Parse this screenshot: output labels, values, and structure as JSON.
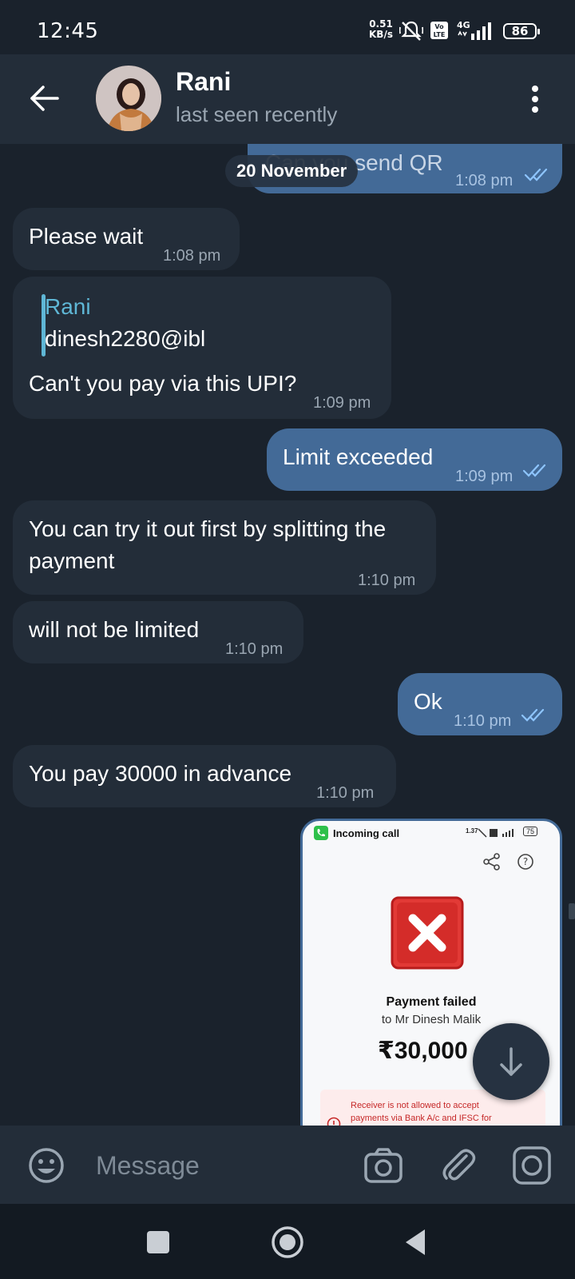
{
  "status_bar": {
    "time": "12:45",
    "speed_value": "0.51",
    "speed_unit": "KB/s",
    "network": "4G",
    "volte": "Vo LTE",
    "battery": "86"
  },
  "header": {
    "name": "Rani",
    "status": "last seen recently"
  },
  "date_separator": "20 November",
  "messages": [
    {
      "side": "out",
      "text": "Can you send QR",
      "time": "1:08 pm"
    },
    {
      "side": "in",
      "text": "Please wait",
      "time": "1:08 pm"
    },
    {
      "side": "in",
      "reply_name": "Rani",
      "reply_text": "dinesh2280@ibl",
      "text": "Can't you pay via this UPI?",
      "time": "1:09 pm"
    },
    {
      "side": "out",
      "text": "Limit exceeded",
      "time": "1:09 pm"
    },
    {
      "side": "in",
      "text": "You can try it out first by splitting the payment",
      "time": "1:10 pm"
    },
    {
      "side": "in",
      "text": "will not be limited",
      "time": "1:10 pm"
    },
    {
      "side": "out",
      "text": "Ok",
      "time": "1:10 pm"
    },
    {
      "side": "in",
      "text": "You pay 30000 in advance",
      "time": "1:10 pm"
    }
  ],
  "image_message": {
    "inner_status_label": "Incoming call",
    "inner_speed": "1.37",
    "inner_battery": "75",
    "title": "Payment failed",
    "recipient": "to Mr Dinesh Malik",
    "amount": "₹30,000",
    "error_line1": "Receiver is not allowed to accept",
    "error_line2": "payments via Bank A/c and IFSC for"
  },
  "input": {
    "placeholder": "Message"
  },
  "colors": {
    "background": "#1a222c",
    "header": "#232d39",
    "incoming_bubble": "#232d39",
    "outgoing_bubble": "#436a97",
    "reply_accent": "#5fb7d6",
    "tick": "#8ec5ff"
  },
  "icons": {
    "back": "arrow-left-icon",
    "menu": "more-vertical-icon",
    "emoji": "emoji-icon",
    "camera": "camera-icon",
    "attach": "paperclip-icon",
    "video_message": "instagram-camera-icon",
    "scroll_down": "arrow-down-icon"
  }
}
